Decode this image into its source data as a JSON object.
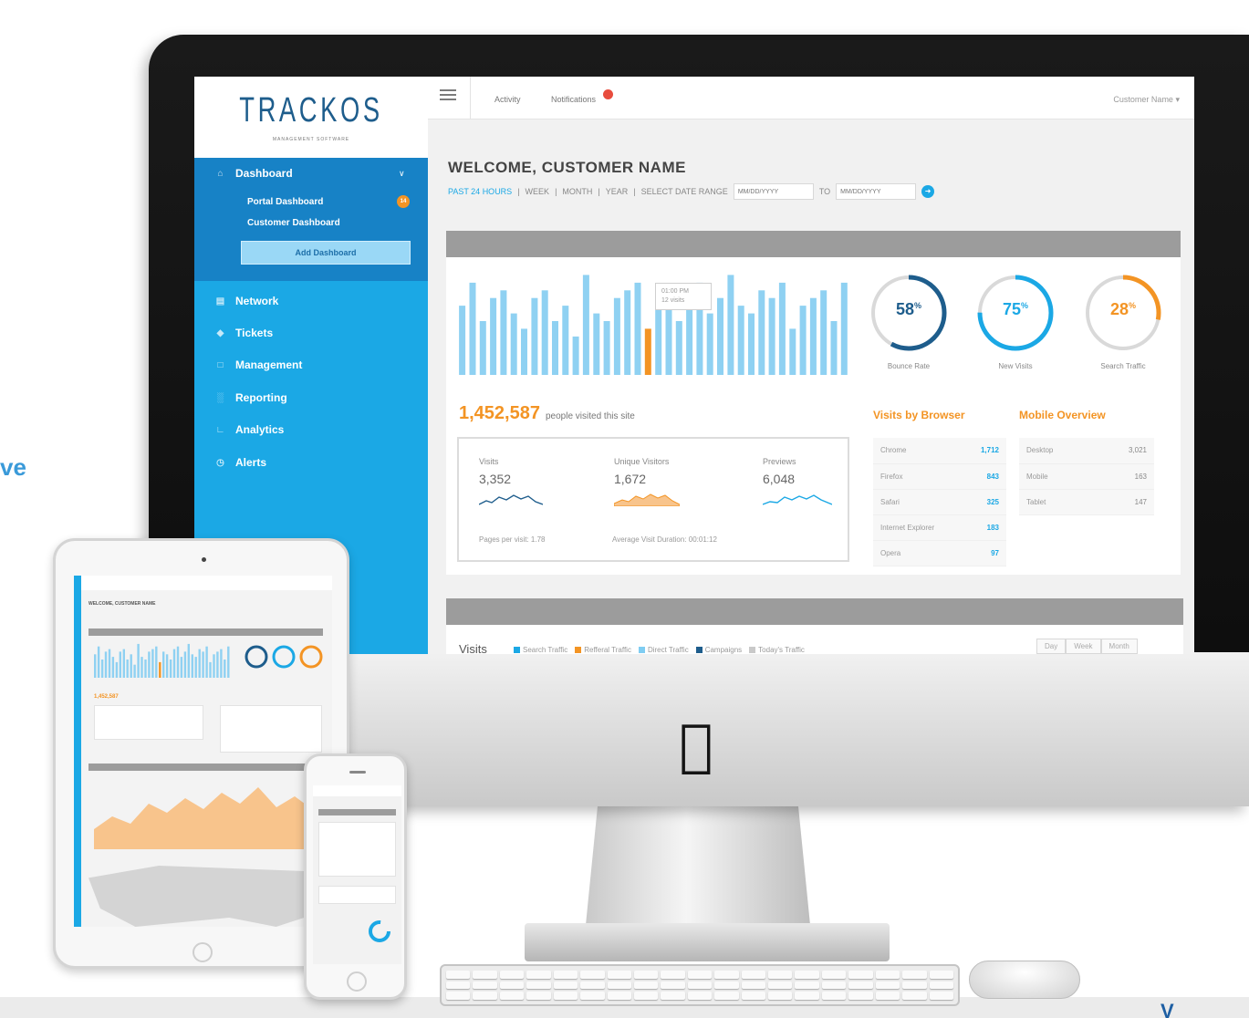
{
  "page": {
    "side_fragment": "ve",
    "corner_fragment": "V"
  },
  "brand": {
    "name": "TRACKOS",
    "subtitle": "MANAGEMENT SOFTWARE"
  },
  "sidebar": {
    "dashboard": {
      "label": "Dashboard",
      "icon": "home-icon"
    },
    "sub_items": [
      {
        "label": "Portal Dashboard",
        "badge": "14"
      },
      {
        "label": "Customer Dashboard"
      }
    ],
    "add_button": "Add Dashboard",
    "items": [
      {
        "label": "Network",
        "icon": "network-icon"
      },
      {
        "label": "Tickets",
        "icon": "ticket-icon"
      },
      {
        "label": "Management",
        "icon": "calendar-icon"
      },
      {
        "label": "Reporting",
        "icon": "bar-chart-icon"
      },
      {
        "label": "Analytics",
        "icon": "line-chart-icon"
      },
      {
        "label": "Alerts",
        "icon": "clock-icon"
      }
    ]
  },
  "topbar": {
    "activity": "Activity",
    "notifications": "Notifications",
    "user": "Customer Name"
  },
  "main": {
    "welcome": "WELCOME, CUSTOMER NAME",
    "ranges": [
      "PAST 24 HOURS",
      "WEEK",
      "MONTH",
      "YEAR",
      "SELECT DATE RANGE"
    ],
    "to_label": "TO",
    "date_from_placeholder": "MM/DD/YYYY",
    "date_to_placeholder": "MM/DD/YYYY"
  },
  "tooltip": {
    "time": "01:00 PM",
    "visits": "12 visits"
  },
  "rings": [
    {
      "value": "58",
      "suffix": "%",
      "label": "Bounce Rate",
      "percent": 58,
      "color": "#1e5d8c"
    },
    {
      "value": "75",
      "suffix": "%",
      "label": "New Visits",
      "percent": 75,
      "color": "#1ba8e5"
    },
    {
      "value": "28",
      "suffix": "%",
      "label": "Search Traffic",
      "percent": 28,
      "color": "#f39424"
    }
  ],
  "visitors": {
    "count": "1,452,587",
    "text": "people visited this site"
  },
  "stats": [
    {
      "label": "Visits",
      "value": "3,352",
      "color": "#1e5d8c"
    },
    {
      "label": "Unique Visitors",
      "value": "1,672",
      "color": "#f39424"
    },
    {
      "label": "Previews",
      "value": "6,048",
      "color": "#1ba8e5"
    }
  ],
  "stats_footer": {
    "pages": "Pages per visit: 1.78",
    "duration": "Average Visit Duration: 00:01:12"
  },
  "browsers": {
    "title": "Visits by Browser",
    "rows": [
      {
        "name": "Chrome",
        "value": "1,712"
      },
      {
        "name": "Firefox",
        "value": "843"
      },
      {
        "name": "Safari",
        "value": "325"
      },
      {
        "name": "Internet Explorer",
        "value": "183"
      },
      {
        "name": "Opera",
        "value": "97"
      }
    ]
  },
  "mobile": {
    "title": "Mobile Overview",
    "rows": [
      {
        "name": "Desktop",
        "value": "3,021"
      },
      {
        "name": "Mobile",
        "value": "163"
      },
      {
        "name": "Tablet",
        "value": "147"
      }
    ]
  },
  "visits_section": {
    "title": "Visits",
    "legend": [
      {
        "label": "Search Traffic",
        "color": "#1ba8e5"
      },
      {
        "label": "Refferal Traffic",
        "color": "#f39424"
      },
      {
        "label": "Direct Traffic",
        "color": "#7fcdf2"
      },
      {
        "label": "Campaigns",
        "color": "#1e5d8c"
      },
      {
        "label": "Today's Traffic",
        "color": "#c9c9c9"
      }
    ],
    "periods": [
      "Day",
      "Week",
      "Month"
    ]
  },
  "chart_data": {
    "type": "bar",
    "title": "",
    "values": [
      9,
      12,
      7,
      10,
      11,
      8,
      6,
      10,
      11,
      7,
      9,
      5,
      13,
      8,
      7,
      10,
      11,
      12,
      6,
      10,
      9,
      7,
      11,
      12,
      8,
      10,
      13,
      9,
      8,
      11,
      10,
      12,
      6,
      9,
      10,
      11,
      7,
      12
    ],
    "highlight_index": 18,
    "bar_color": "#8fd1f2",
    "highlight_color": "#f39424",
    "ylim": [
      0,
      14
    ]
  },
  "ipad": {
    "title": "WELCOME, CUSTOMER NAME",
    "count": "1,452,587"
  }
}
